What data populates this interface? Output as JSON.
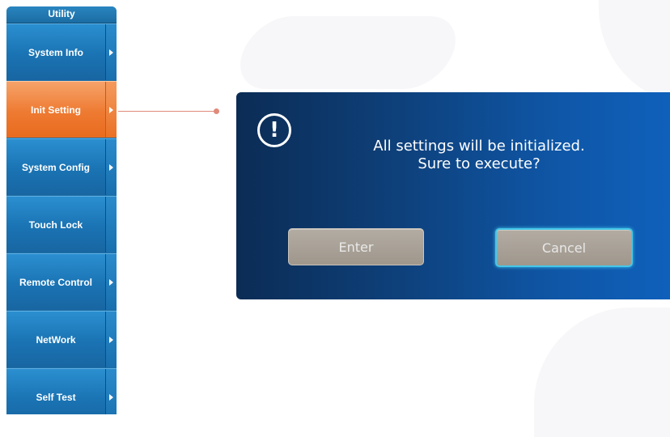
{
  "menu": {
    "title": "Utility",
    "items": [
      {
        "label": "System Info",
        "has_submenu": true,
        "active": false
      },
      {
        "label": "Init Setting",
        "has_submenu": true,
        "active": true
      },
      {
        "label": "System Config",
        "has_submenu": true,
        "active": false
      },
      {
        "label": "Touch Lock",
        "has_submenu": false,
        "active": false
      },
      {
        "label": "Remote Control",
        "has_submenu": true,
        "active": false
      },
      {
        "label": "NetWork",
        "has_submenu": true,
        "active": false
      },
      {
        "label": "Self Test",
        "has_submenu": true,
        "active": false
      }
    ]
  },
  "dialog": {
    "icon": "exclamation-circle-icon",
    "message_line1": "All settings will be initialized.",
    "message_line2": "Sure to execute?",
    "enter_label": "Enter",
    "cancel_label": "Cancel",
    "focused_button": "Cancel"
  },
  "colors": {
    "menu_blue": "#1d6fa6",
    "active_orange": "#ee7a31",
    "dialog_blue": "#0f57a8",
    "button_gray": "#a9a196",
    "focus_cyan": "#46c7e8",
    "connector": "#e08a7a"
  }
}
